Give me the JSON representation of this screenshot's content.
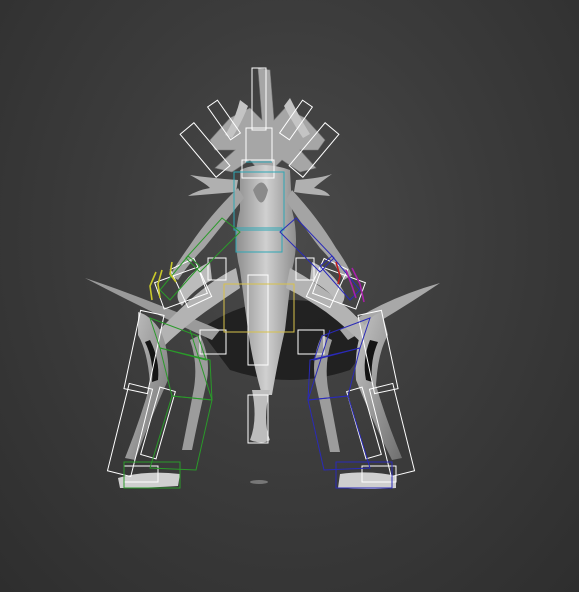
{
  "viewport": {
    "background_color": "#3c3c3c",
    "mesh_color": "#b9b9b9",
    "mesh_shadow_color": "#1c1c1c",
    "bone_color_center": "#ffffff",
    "bone_color_spine": "#2ea7b5",
    "bone_color_pelvis": "#d8c24a",
    "bone_color_left_limb": "#2a9a2a",
    "bone_color_right_limb": "#2a2ab8",
    "finger_color_left": "#c8c82a",
    "finger_color_right": "#a820a8",
    "accent_red": "#c02020"
  },
  "scene": {
    "subject": "rigged-creature-model",
    "view": "front"
  }
}
